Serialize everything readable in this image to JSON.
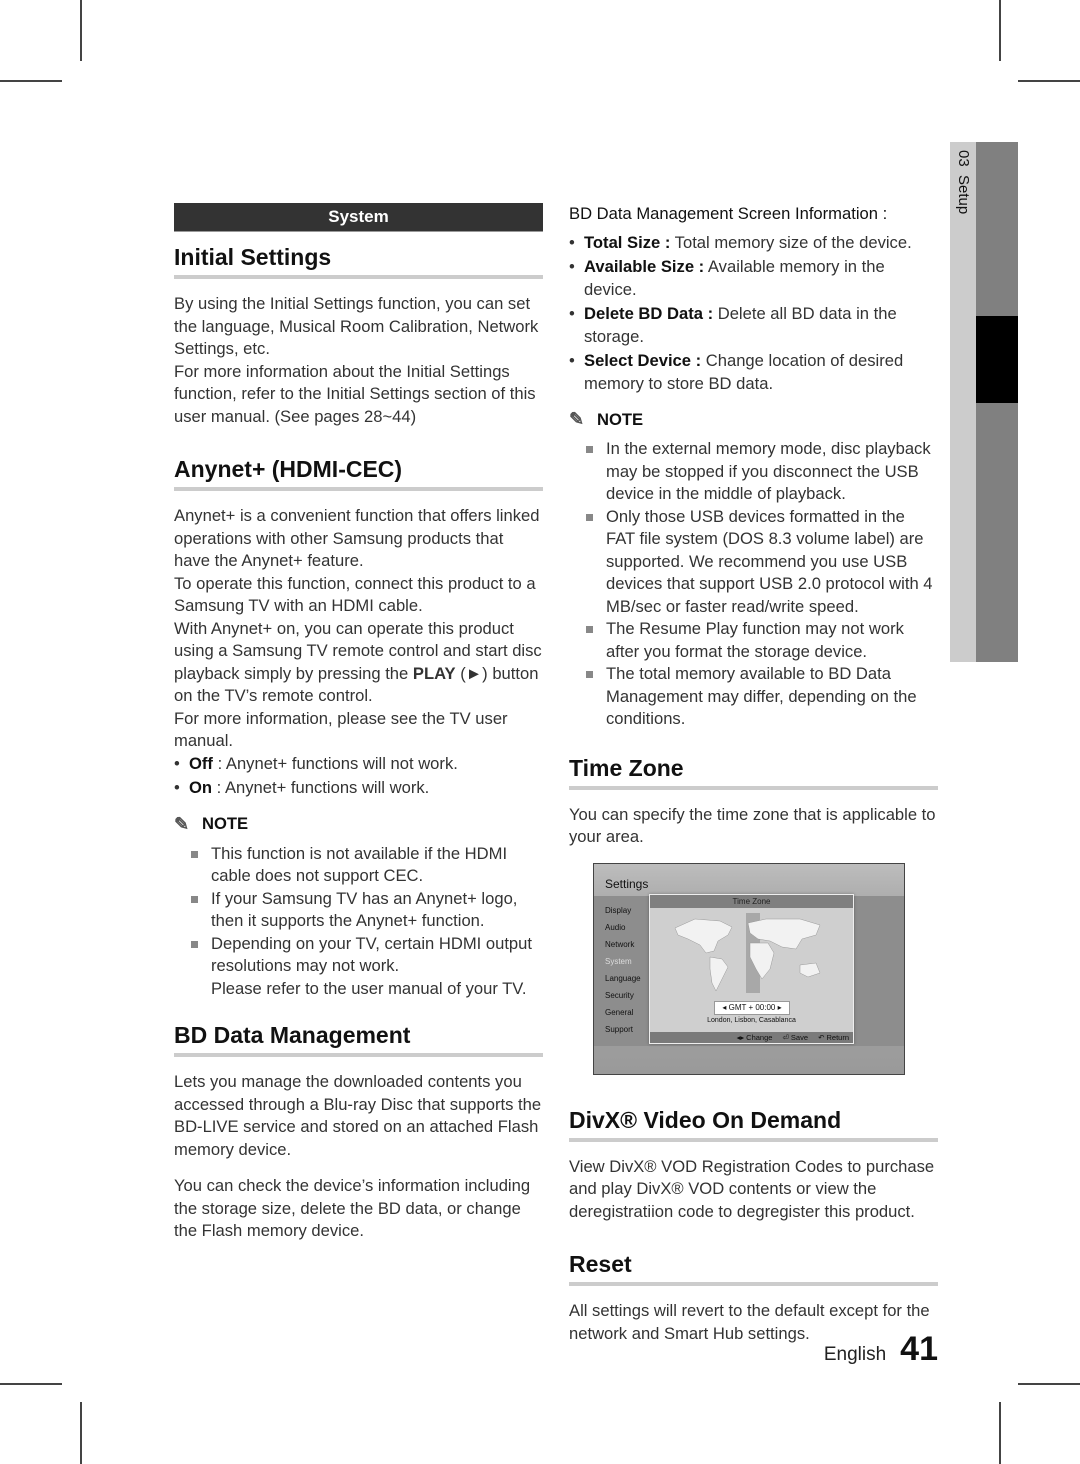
{
  "section_bar": "System",
  "left": {
    "initial_settings": {
      "heading": "Initial Settings",
      "paragraphs": [
        "By using the Initial Settings function, you can set the language, Musical Room Calibration, Network Settings, etc.",
        "For more information about the Initial Settings function, refer to the Initial Settings section of this user manual. (See pages 28~44)"
      ]
    },
    "anynet": {
      "heading": "Anynet+ (HDMI-CEC)",
      "paragraphs": [
        "Anynet+ is a convenient function that offers linked operations with other Samsung products that have the Anynet+ feature.",
        "To operate this function, connect this product to a Samsung TV with an HDMI cable.",
        "With Anynet+ on, you can operate this product using a Samsung TV remote control and start disc playback simply by pressing the ",
        "For more information, please see the TV user manual."
      ],
      "play_label": "PLAY",
      "play_suffix": " (►) button on the TV’s remote control.",
      "bullets": [
        {
          "term": "Off",
          "text": " : Anynet+ functions will not work."
        },
        {
          "term": "On",
          "text": " : Anynet+ functions will work."
        }
      ],
      "note_label": "NOTE",
      "notes": [
        "This function is not available if the HDMI cable does not support CEC.",
        "If your Samsung TV has an Anynet+ logo, then it supports the Anynet+ function.",
        "Depending on your TV, certain HDMI output resolutions may not work."
      ],
      "note_extra": "Please refer to the user manual of your TV."
    },
    "bd_data": {
      "heading": "BD Data Management",
      "paragraphs": [
        "Lets you manage the downloaded contents you accessed through a Blu-ray Disc that supports the BD-LIVE service and stored on an attached Flash memory device.",
        "You can check the device’s information including the storage size, delete the BD data, or change the Flash memory device."
      ]
    }
  },
  "right": {
    "bd_screen_info": {
      "title": "BD Data Management Screen Information :",
      "bullets": [
        {
          "term": "Total Size :",
          "text": " Total memory size of the device."
        },
        {
          "term": "Available Size :",
          "text": " Available memory in the device."
        },
        {
          "term": "Delete BD Data :",
          "text": " Delete all BD data in the storage."
        },
        {
          "term": "Select Device :",
          "text": " Change location of desired memory to store BD data."
        }
      ],
      "note_label": "NOTE",
      "notes": [
        "In the external memory mode, disc playback may be stopped if you disconnect the USB device in the middle of playback.",
        "Only those USB devices formatted in the FAT file system (DOS 8.3 volume label) are supported. We recommend you use USB devices that support USB 2.0 protocol with 4 MB/sec or faster read/write speed.",
        "The Resume Play function may not work after you format the storage device.",
        "The total memory available to BD Data Management may differ, depending on the conditions."
      ]
    },
    "time_zone": {
      "heading": "Time Zone",
      "paragraph": "You can specify the time zone that is applicable to your area.",
      "screen": {
        "title": "Settings",
        "menu": [
          "Display",
          "Audio",
          "Network",
          "System",
          "Language",
          "Security",
          "General",
          "Support"
        ],
        "active_menu": "System",
        "popup_title": "Time Zone",
        "gmt_value": "GMT + 00:00",
        "cities": "London, Lisbon, Casablanca",
        "footer": {
          "change": "◂▸ Change",
          "save": "⏎ Save",
          "return": "↶ Return"
        }
      }
    },
    "divx": {
      "heading": "DivX® Video On Demand",
      "paragraph": "View DivX® VOD Registration Codes to purchase and play DivX® VOD contents or view the deregistratiion code to degregister this product."
    },
    "reset": {
      "heading": "Reset",
      "paragraph": "All settings will revert to the default except for the network and Smart Hub settings."
    }
  },
  "side_tab": {
    "chapter": "03",
    "label": "Setup"
  },
  "footer": {
    "language": "English",
    "page_number": "41"
  }
}
